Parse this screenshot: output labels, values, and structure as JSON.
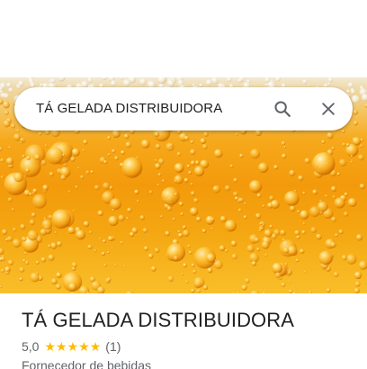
{
  "search": {
    "query": "TÁ GELADA DISTRIBUIDORA"
  },
  "hero": {
    "image_icon": "beer-bubbles-photo"
  },
  "place": {
    "title": "TÁ GELADA DISTRIBUIDORA",
    "rating": "5,0",
    "stars": 5,
    "review_count": "(1)",
    "category": "Fornecedor de bebidas"
  },
  "icons": {
    "search": "search-icon",
    "close": "close-icon",
    "star": "star-icon"
  },
  "colors": {
    "star": "#fbbc04",
    "title": "#202124",
    "secondary_text": "#5f6368",
    "beer_orange": "#f39a0b"
  }
}
